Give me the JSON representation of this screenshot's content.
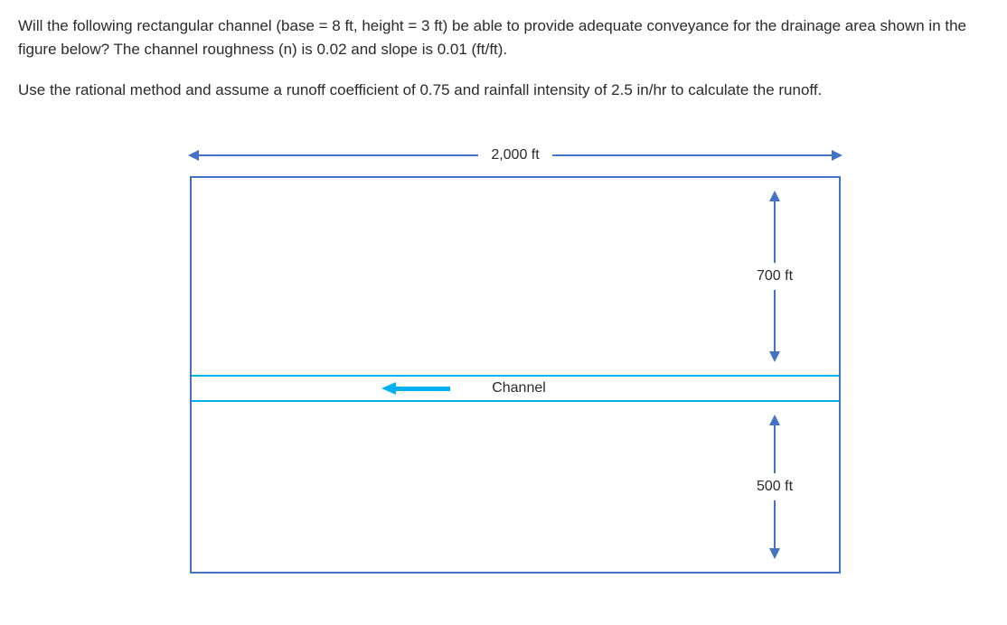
{
  "question": {
    "p1": "Will the following rectangular channel (base = 8 ft, height = 3 ft) be able to provide adequate conveyance for the drainage area shown in the figure below? The channel roughness (n) is 0.02 and slope is 0.01 (ft/ft).",
    "p2": "Use the rational method and assume a runoff coefficient of 0.75 and rainfall intensity of 2.5 in/hr to calculate the runoff."
  },
  "figure": {
    "width_label": "2,000 ft",
    "upper_height_label": "700 ft",
    "lower_height_label": "500 ft",
    "channel_label": "Channel"
  },
  "chart_data": {
    "type": "diagram",
    "drainage_area": {
      "total_width_ft": 2000,
      "upper_strip_height_ft": 700,
      "lower_strip_height_ft": 500,
      "total_height_ft": 1200
    },
    "channel": {
      "shape": "rectangular",
      "base_ft": 8,
      "height_ft": 3,
      "manning_n": 0.02,
      "slope_ft_per_ft": 0.01,
      "flow_direction": "left"
    },
    "rational_method": {
      "runoff_coefficient_C": 0.75,
      "rainfall_intensity_in_per_hr": 2.5
    }
  }
}
